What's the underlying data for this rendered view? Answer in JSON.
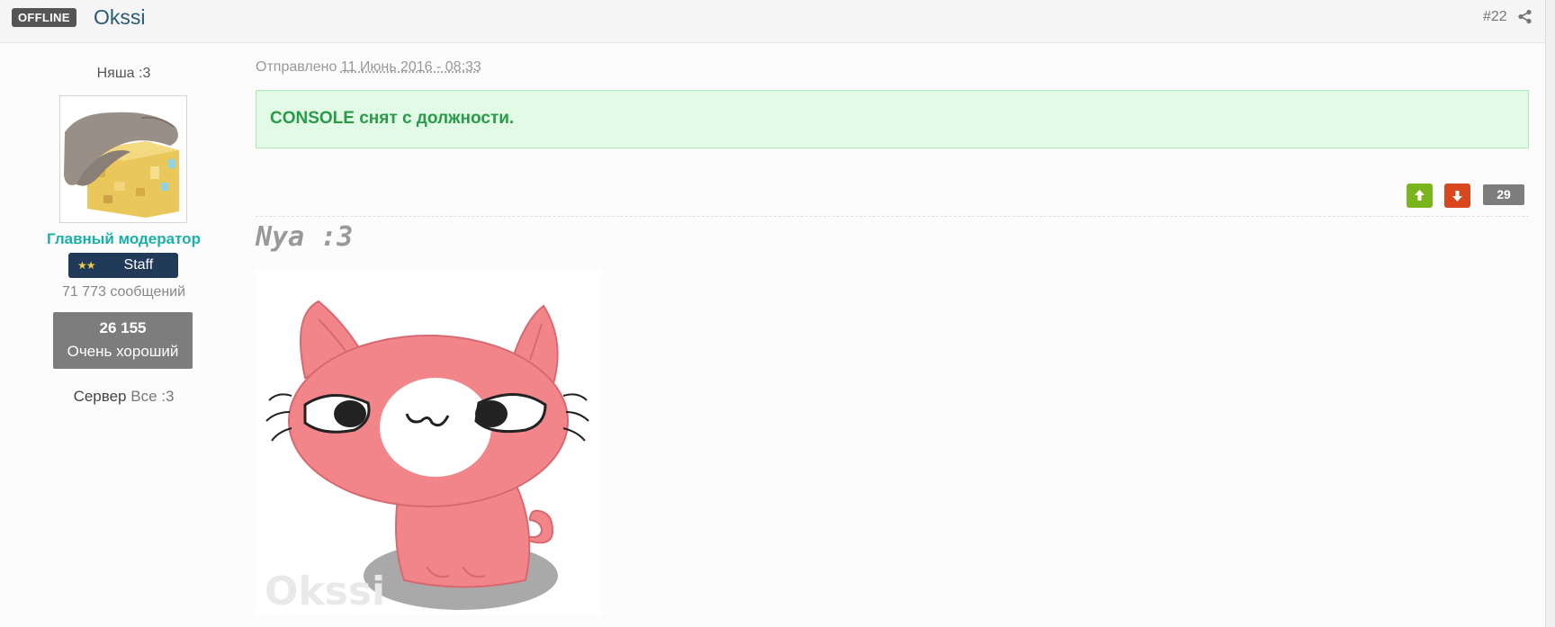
{
  "header": {
    "status": "OFFLINE",
    "author": "Okssi",
    "post_number": "#22",
    "share_icon": "share-icon"
  },
  "author_info": {
    "user_title": "Няша :3",
    "group": "Главный модератор",
    "badge_label": "Staff",
    "badge_stars": "★★",
    "post_count": "71 773 сообщений",
    "reputation_value": "26 155",
    "reputation_label": "Очень хороший",
    "server_label": "Сервер",
    "server_value": "Все :3"
  },
  "post": {
    "date_prefix": "Отправлено",
    "date_value": "11 Июнь 2016 - 08:33",
    "notice_text": "CONSOLE снят с должности.",
    "vote_count": "29"
  },
  "signature": {
    "text": "Nya :3",
    "image_watermark": "Okssi"
  },
  "colors": {
    "group": "#1ab0a9",
    "notice_bg": "#e2fbe6",
    "notice_text": "#2a9a4a",
    "vote_up": "#7ab51d",
    "vote_down": "#d9481c"
  }
}
